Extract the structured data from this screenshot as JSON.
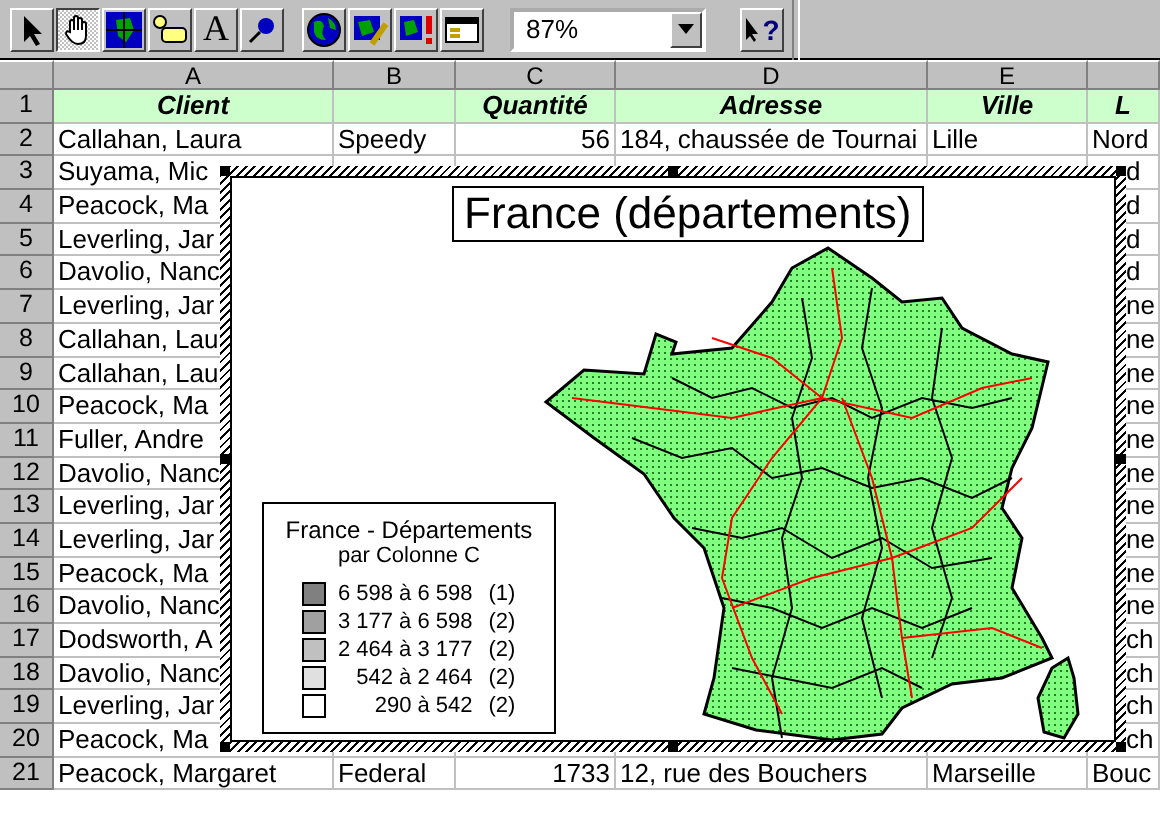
{
  "toolbar": {
    "tools": [
      {
        "kind": "pointer",
        "selected": false
      },
      {
        "kind": "hand",
        "selected": true
      },
      {
        "kind": "map-grid",
        "selected": false
      },
      {
        "kind": "label",
        "selected": false
      },
      {
        "kind": "text",
        "glyph": "A",
        "selected": false
      },
      {
        "kind": "pin",
        "selected": false
      }
    ],
    "map_tools": [
      {
        "kind": "globe"
      },
      {
        "kind": "map-pencil"
      },
      {
        "kind": "map-alert"
      },
      {
        "kind": "table"
      }
    ],
    "zoom_box": {
      "value": "87%"
    },
    "help": {
      "glyph": "?"
    }
  },
  "sheet": {
    "columns": [
      "A",
      "B",
      "C",
      "D",
      "E"
    ],
    "rows": [
      {
        "number": "1",
        "kind": "header",
        "cells": {
          "A": "Client",
          "C": "Quantité",
          "D": "Adresse",
          "E": "Ville",
          "F": "L"
        }
      },
      {
        "number": "2",
        "kind": "data",
        "cells": {
          "A": "Callahan, Laura",
          "B": "Speedy",
          "C": "56",
          "D": "184, chaussée de Tournai",
          "E": "Lille",
          "F": "Nord"
        }
      },
      {
        "number": "3",
        "kind": "partial",
        "cells": {
          "A": "Suyama, Mic",
          "F": "d"
        }
      },
      {
        "number": "4",
        "kind": "partial",
        "cells": {
          "A": "Peacock, Ma",
          "F": "d"
        }
      },
      {
        "number": "5",
        "kind": "partial",
        "cells": {
          "A": "Leverling, Jar",
          "F": "d"
        }
      },
      {
        "number": "6",
        "kind": "partial",
        "cells": {
          "A": "Davolio, Nanc",
          "F": "d"
        }
      },
      {
        "number": "7",
        "kind": "partial",
        "cells": {
          "A": "Leverling, Jar",
          "F": "ne"
        }
      },
      {
        "number": "8",
        "kind": "partial",
        "cells": {
          "A": "Callahan, Lau",
          "F": "ne"
        }
      },
      {
        "number": "9",
        "kind": "partial",
        "cells": {
          "A": "Callahan, Lau",
          "F": "ne"
        }
      },
      {
        "number": "10",
        "kind": "partial",
        "cells": {
          "A": "Peacock, Ma",
          "F": "ne"
        }
      },
      {
        "number": "11",
        "kind": "partial",
        "cells": {
          "A": "Fuller, Andre",
          "F": "ne"
        }
      },
      {
        "number": "12",
        "kind": "partial",
        "cells": {
          "A": "Davolio, Nanc",
          "F": "ne"
        }
      },
      {
        "number": "13",
        "kind": "partial",
        "cells": {
          "A": "Leverling, Jar",
          "F": "ne"
        }
      },
      {
        "number": "14",
        "kind": "partial",
        "cells": {
          "A": "Leverling, Jar",
          "F": "ne"
        }
      },
      {
        "number": "15",
        "kind": "partial",
        "cells": {
          "A": "Peacock, Ma",
          "F": "ne"
        }
      },
      {
        "number": "16",
        "kind": "partial",
        "cells": {
          "A": "Davolio, Nanc",
          "F": "ne"
        }
      },
      {
        "number": "17",
        "kind": "partial",
        "cells": {
          "A": "Dodsworth, A",
          "F": "ch"
        }
      },
      {
        "number": "18",
        "kind": "partial",
        "cells": {
          "A": "Davolio, Nanc",
          "F": "ch"
        }
      },
      {
        "number": "19",
        "kind": "partial",
        "cells": {
          "A": "Leverling, Jar",
          "F": "ch"
        }
      },
      {
        "number": "20",
        "kind": "partial",
        "cells": {
          "A": "Peacock, Ma",
          "F": "ch"
        }
      },
      {
        "number": "21",
        "kind": "data",
        "cells": {
          "A": "Peacock, Margaret",
          "B": "Federal",
          "C": "1733",
          "D": "12, rue des Bouchers",
          "E": "Marseille",
          "F": "Bouc"
        }
      }
    ]
  },
  "map": {
    "title": "France (départements)",
    "legend": {
      "title": "France - Départements",
      "subtitle": "par Colonne C",
      "items": [
        {
          "range": "6 598 à 6 598",
          "count": "(1)",
          "color": "#808080"
        },
        {
          "range": "3 177 à 6 598",
          "count": "(2)",
          "color": "#a0a0a0"
        },
        {
          "range": "2 464 à 3 177",
          "count": "(2)",
          "color": "#c0c0c0"
        },
        {
          "range": "542 à 2 464",
          "count": "(2)",
          "color": "#e0e0e0"
        },
        {
          "range": "290 à 542",
          "count": "(2)",
          "color": "#ffffff"
        }
      ]
    }
  }
}
